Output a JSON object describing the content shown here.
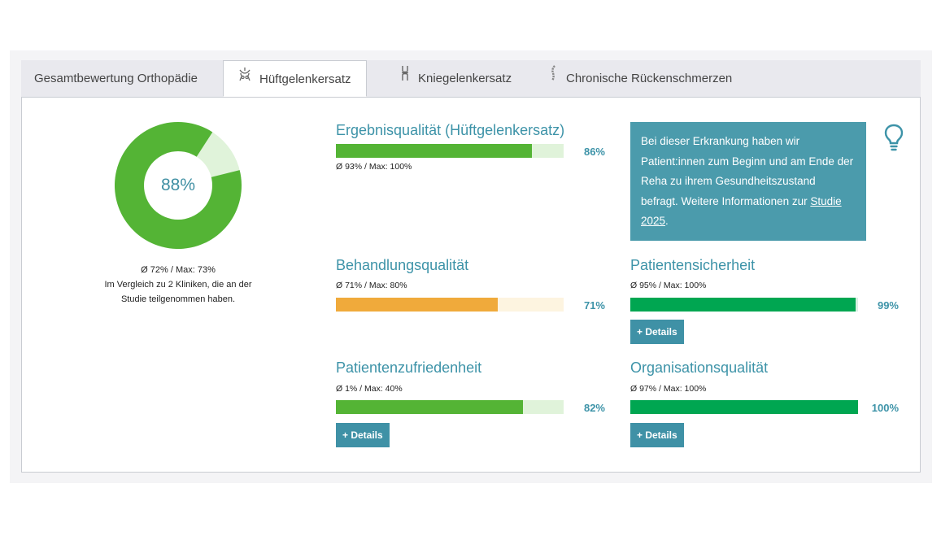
{
  "colors": {
    "accent": "#3d93a8",
    "green": "#54b435",
    "green_light": "#e0f3da",
    "orange": "#f0aa3b",
    "orange_light": "#fdf4e0",
    "teal_green": "#00a651",
    "teal_green_light": "#d6f0e1",
    "info_bg": "#4b9bac"
  },
  "tabs": [
    {
      "label": "Gesamtbewertung Orthopädie",
      "icon": "",
      "active": false
    },
    {
      "label": "Hüftgelenkersatz",
      "icon": "hip-joint-icon",
      "active": true
    },
    {
      "label": "Kniegelenkersatz",
      "icon": "knee-joint-icon",
      "active": false
    },
    {
      "label": "Chronische Rückenschmerzen",
      "icon": "spine-icon",
      "active": false
    }
  ],
  "overall": {
    "value_label": "88%",
    "value": 88,
    "avg_line": "Ø 72% / Max: 73%",
    "compare_line1": "Im Vergleich zu 2 Kliniken, die an der",
    "compare_line2": "Studie teilgenommen haben."
  },
  "metrics": {
    "ergebnis": {
      "title": "Ergebnisqualität (Hüftgelenkersatz)",
      "stats": "Ø 93% / Max: 100%",
      "value": 86,
      "value_label": "86%"
    },
    "behandlung": {
      "title": "Behandlungsqualität",
      "stats": "Ø 71% / Max: 80%",
      "value": 71,
      "value_label": "71%"
    },
    "zufriedenheit": {
      "title": "Patientenzufriedenheit",
      "stats": "Ø 1% / Max: 40%",
      "value": 82,
      "value_label": "82%",
      "details_label": "+ Details"
    },
    "sicherheit": {
      "title": "Patientensicherheit",
      "stats": "Ø 95% / Max: 100%",
      "value": 99,
      "value_label": "99%",
      "details_label": "+ Details"
    },
    "organisation": {
      "title": "Organisationsqualität",
      "stats": "Ø 97% / Max: 100%",
      "value": 100,
      "value_label": "100%",
      "details_label": "+ Details"
    }
  },
  "info": {
    "text": "Bei dieser Erkrankung haben wir Patient:innen zum Beginn und am Ende der Reha zu ihrem Gesundheitszustand befragt. Weitere Informationen zur ",
    "link": "Studie 2025",
    "suffix": ".",
    "icon": "lightbulb-icon"
  }
}
